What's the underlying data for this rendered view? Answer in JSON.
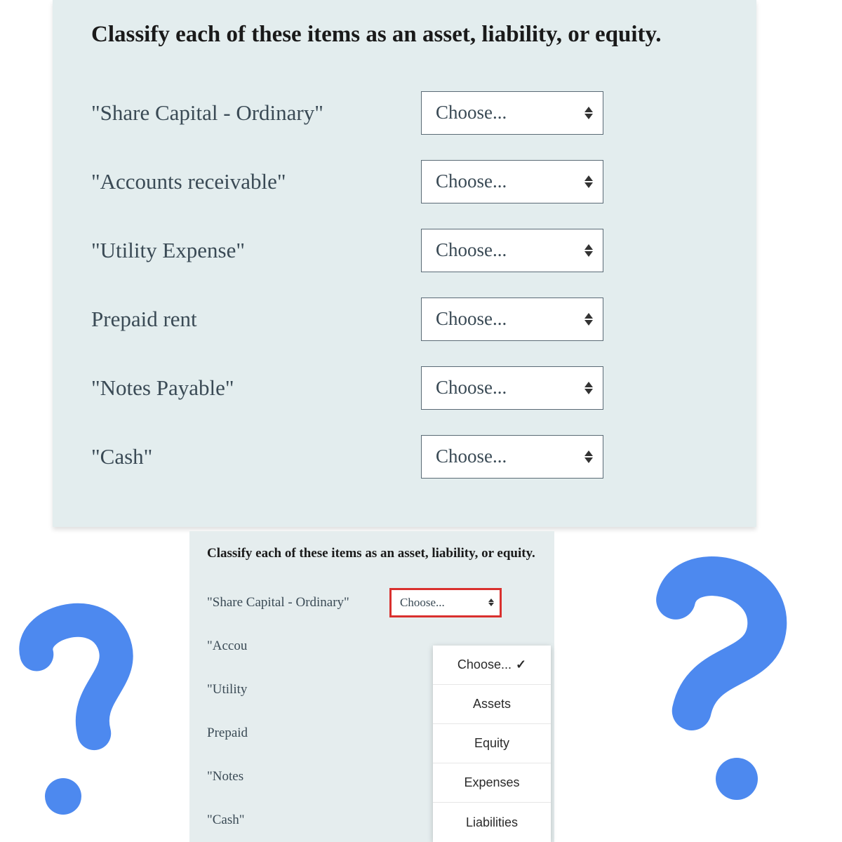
{
  "panel1": {
    "question": "Classify each of these items as an asset, liability, or equity.",
    "rows": [
      {
        "label": "\"Share Capital - Ordinary\"",
        "value": "Choose..."
      },
      {
        "label": "\"Accounts receivable\"",
        "value": "Choose..."
      },
      {
        "label": "\"Utility Expense\"",
        "value": "Choose..."
      },
      {
        "label": "Prepaid rent",
        "value": "Choose..."
      },
      {
        "label": "\"Notes Payable\"",
        "value": "Choose..."
      },
      {
        "label": "\"Cash\"",
        "value": "Choose..."
      }
    ]
  },
  "panel2": {
    "question": "Classify each of these items as an asset, liability, or equity.",
    "rows": [
      {
        "label": "\"Share Capital - Ordinary\"",
        "value": "Choose..."
      },
      {
        "label": "\"Accou",
        "value": ""
      },
      {
        "label": "\"Utility",
        "value": ""
      },
      {
        "label": "Prepaid",
        "value": ""
      },
      {
        "label": "\"Notes",
        "value": ""
      },
      {
        "label": "\"Cash\"",
        "value": ""
      }
    ]
  },
  "dropdown": {
    "options": [
      {
        "text": "Choose...",
        "checked": true
      },
      {
        "text": "Assets",
        "checked": false
      },
      {
        "text": "Equity",
        "checked": false
      },
      {
        "text": "Expenses",
        "checked": false
      },
      {
        "text": "Liabilities",
        "checked": false
      }
    ]
  }
}
